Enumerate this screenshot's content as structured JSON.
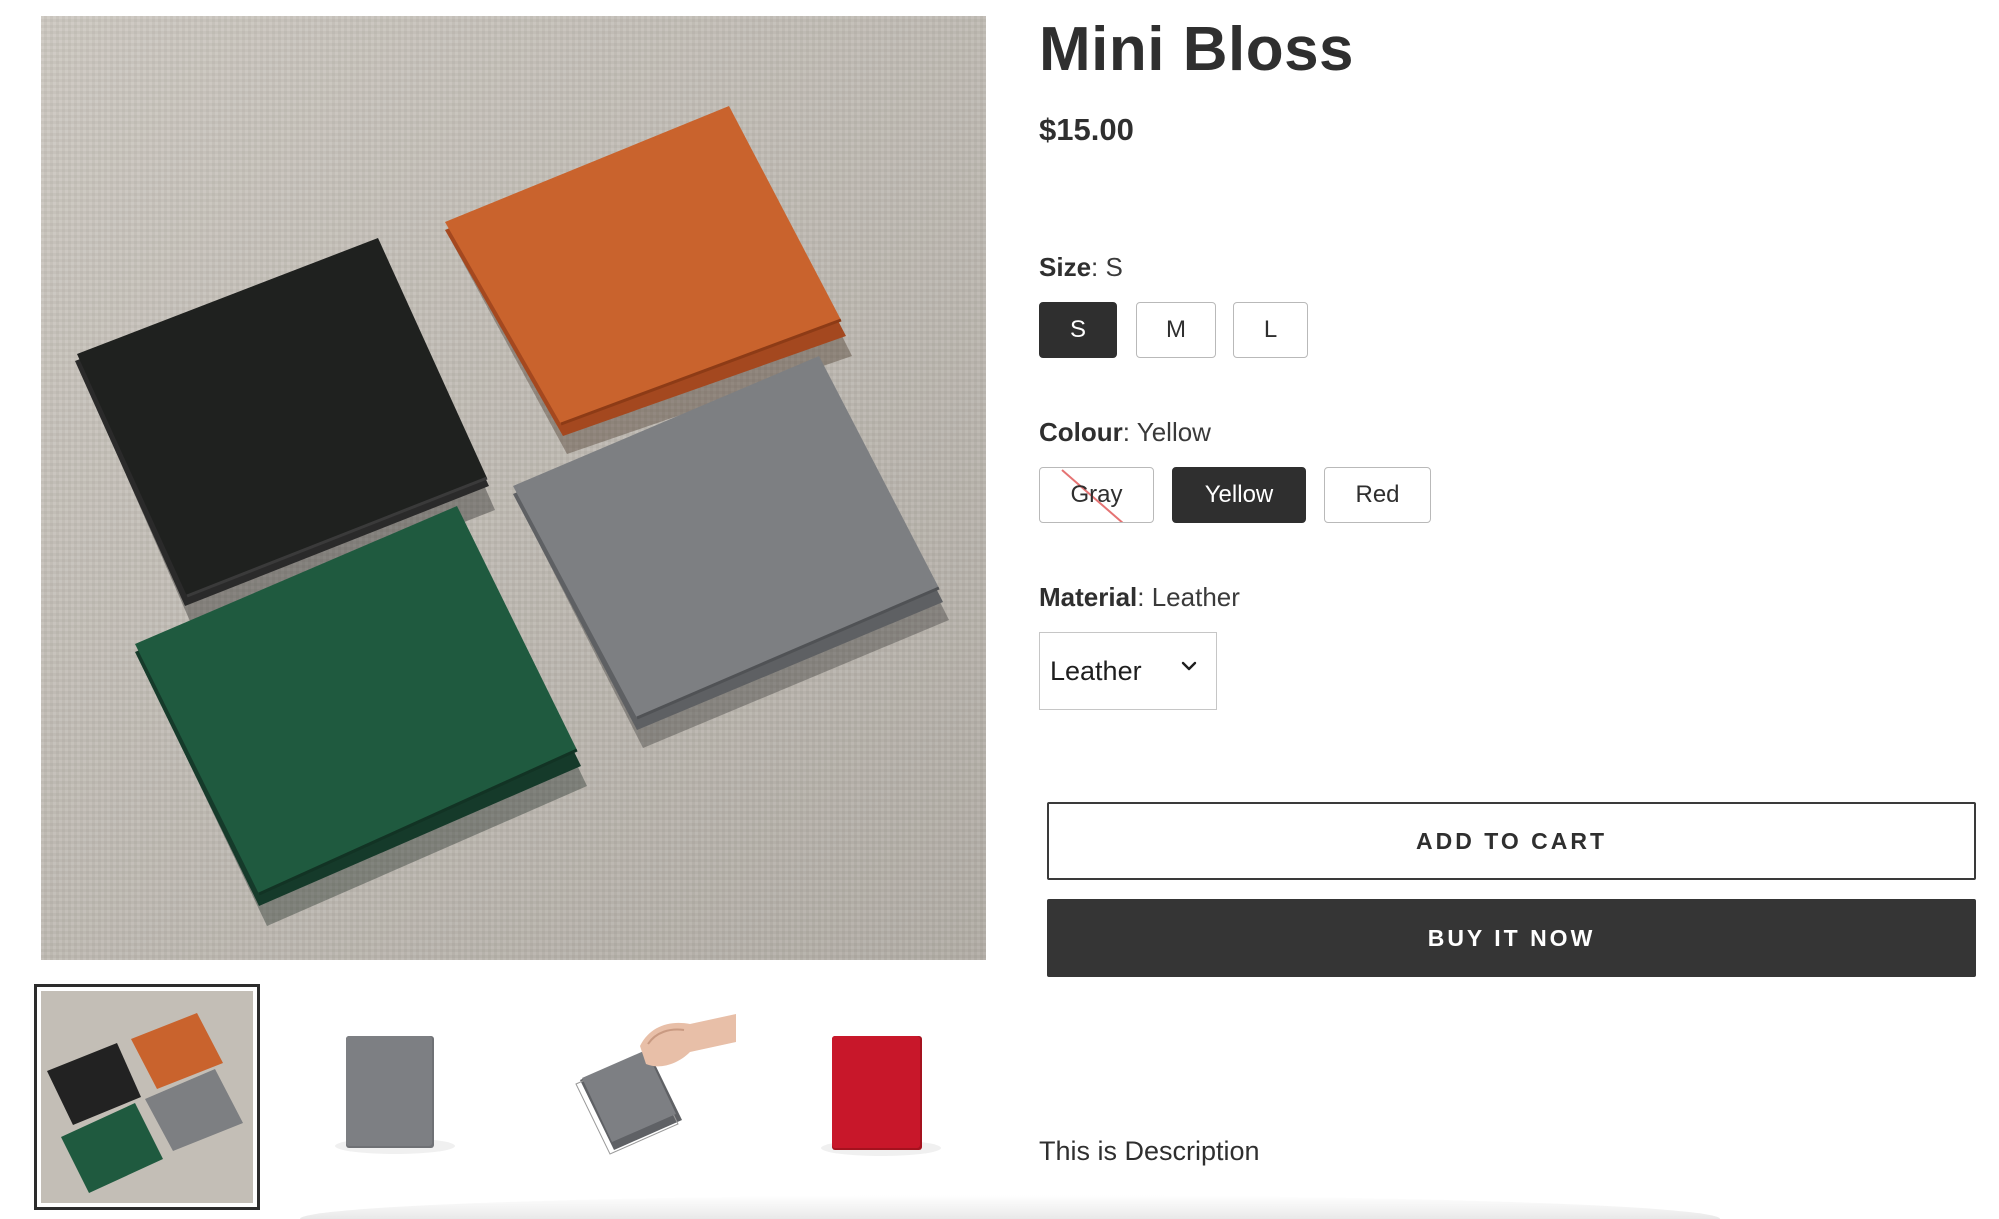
{
  "product": {
    "title": "Mini Bloss",
    "price": "$15.00",
    "description": "This is Description"
  },
  "gallery": {
    "main_image": "wallets-four-colors-photo",
    "thumbnails": [
      {
        "name": "wallets-four-colors-thumb",
        "active": true
      },
      {
        "name": "gray-wallet-thumb",
        "active": false
      },
      {
        "name": "hand-holding-wallet-thumb",
        "active": false
      },
      {
        "name": "red-wallet-thumb",
        "active": false
      }
    ]
  },
  "options": {
    "size": {
      "label": "Size",
      "value": "S",
      "choices": [
        "S",
        "M",
        "L"
      ]
    },
    "colour": {
      "label": "Colour",
      "value": "Yellow",
      "choices": [
        "Gray",
        "Yellow",
        "Red"
      ],
      "unavailable": [
        "Gray"
      ]
    },
    "material": {
      "label": "Material",
      "value": "Leather",
      "selected": "Leather"
    }
  },
  "buttons": {
    "add_to_cart": "ADD TO CART",
    "buy_now": "BUY IT NOW"
  },
  "colors": {
    "primary_dark": "#2f2f2f",
    "swatch_border": "#b9b9b9",
    "strike_red": "#e57373"
  }
}
